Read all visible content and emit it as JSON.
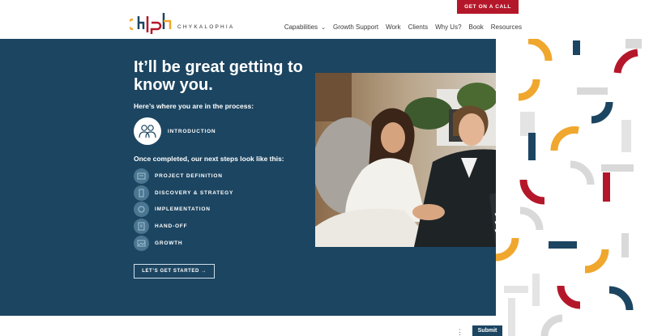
{
  "header": {
    "brand_name": "CHYKALOPHIA",
    "cta_label": "GET ON A CALL",
    "nav": [
      {
        "label": "Capabilities",
        "has_dropdown": true
      },
      {
        "label": "Growth Support"
      },
      {
        "label": "Work"
      },
      {
        "label": "Clients"
      },
      {
        "label": "Why Us?"
      },
      {
        "label": "Book"
      },
      {
        "label": "Resources"
      }
    ]
  },
  "hero": {
    "headline": "It’ll be great getting to know you.",
    "process_label": "Here’s where you are in the process:",
    "current_step": {
      "label": "INTRODUCTION",
      "icon": "people-icon"
    },
    "next_label": "Once completed, our next steps look like this:",
    "steps": [
      {
        "label": "PROJECT DEFINITION",
        "icon": "definition-icon"
      },
      {
        "label": "DISCOVERY & STRATEGY",
        "icon": "discovery-icon"
      },
      {
        "label": "IMPLEMENTATION",
        "icon": "implementation-icon"
      },
      {
        "label": "HAND-OFF",
        "icon": "handoff-icon"
      },
      {
        "label": "GROWTH",
        "icon": "growth-icon"
      }
    ],
    "start_button": "LET’S GET STARTED →"
  },
  "footer": {
    "more_icon": "⋮",
    "submit_label": "Submit"
  },
  "colors": {
    "primary": "#1c4561",
    "accent_red": "#b5172a",
    "accent_orange": "#f0a72e",
    "step_icon_bg": "#4b7691"
  }
}
